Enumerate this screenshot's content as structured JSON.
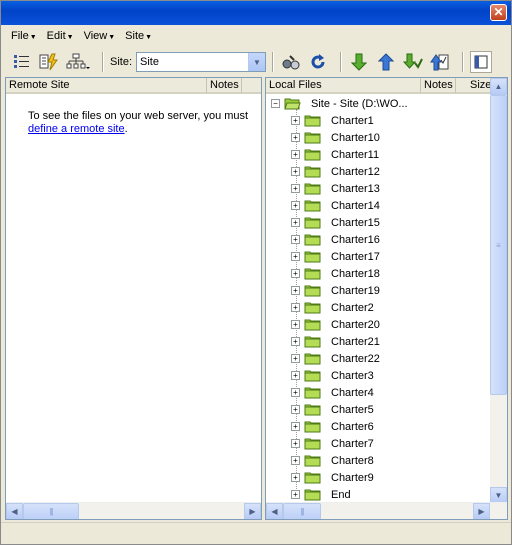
{
  "window": {
    "close_glyph": "✕"
  },
  "menu": [
    {
      "label": "File"
    },
    {
      "label": "Edit"
    },
    {
      "label": "View"
    },
    {
      "label": "Site"
    }
  ],
  "toolbar": {
    "site_label": "Site:",
    "site_value": "Site"
  },
  "remote": {
    "columns": [
      "Remote Site",
      "Notes"
    ],
    "notice_text": "To see the files on your web server, you must",
    "notice_link": "define a remote site",
    "notice_end": "."
  },
  "local": {
    "columns": [
      "Local Files",
      "Notes",
      "Size"
    ],
    "root": "Site - Site (D:\\WO...",
    "folders": [
      "Charter1",
      "Charter10",
      "Charter11",
      "Charter12",
      "Charter13",
      "Charter14",
      "Charter15",
      "Charter16",
      "Charter17",
      "Charter18",
      "Charter19",
      "Charter2",
      "Charter20",
      "Charter21",
      "Charter22",
      "Charter3",
      "Charter4",
      "Charter5",
      "Charter6",
      "Charter7",
      "Charter8",
      "Charter9",
      "End"
    ]
  },
  "colors": {
    "folder": "#9ccf3a",
    "link": "#0000ee"
  }
}
